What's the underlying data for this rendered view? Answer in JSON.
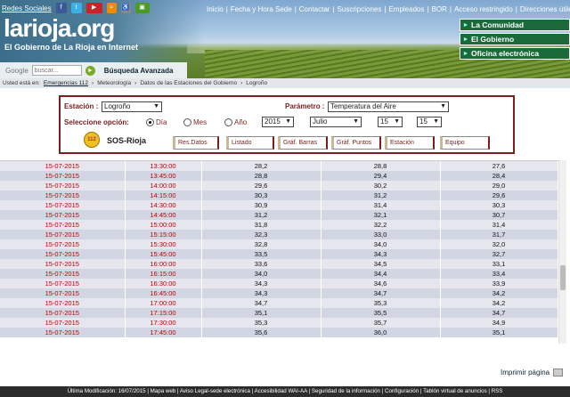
{
  "header": {
    "social_label": "Redes Sociales",
    "logo_main": "lariojа",
    "logo_text": "larioja",
    "logo_suffix": ".org",
    "tagline": "El Gobierno de La Rioja en Internet",
    "top_links": [
      "Inicio",
      "Fecha y Hora Sede",
      "Contactar",
      "Suscripciones",
      "Empleados",
      "BOR",
      "Acceso restringido",
      "Direcciones útiles"
    ],
    "quick_menu": [
      "La Comunidad",
      "El Gobierno",
      "Oficina electrónica"
    ],
    "search": {
      "label": "Google",
      "placeholder": "buscar...",
      "advanced": "Búsqueda Avanzada"
    }
  },
  "breadcrumb": {
    "prefix": "Usted está en:",
    "items": [
      "Emergencias 112",
      "Meteorología",
      "Datos de las Estaciones del Gobierno",
      "Logroño"
    ]
  },
  "form": {
    "station_label": "Estación :",
    "station_value": "Logroño",
    "param_label": "Parámetro :",
    "param_value": "Temperatura del Aire",
    "option_label": "Seleccione opción:",
    "radio_day": "Día",
    "radio_month": "Mes",
    "radio_year": "Año",
    "selected_option": "Día",
    "year": "2015",
    "month": "Julio",
    "day_from": "15",
    "day_to": "15",
    "sos_icon_text": "112",
    "sos_label": "SOS-Rioja",
    "tabs": [
      "Res.Datos",
      "Listado",
      "Gráf. Barras",
      "Gráf. Puntos",
      "Estación",
      "Equipo"
    ]
  },
  "table": {
    "rows": [
      [
        "15-07-2015",
        "13:30:00",
        "28,2",
        "28,8",
        "27,6"
      ],
      [
        "15-07-2015",
        "13:45:00",
        "28,8",
        "29,4",
        "28,4"
      ],
      [
        "15-07-2015",
        "14:00:00",
        "29,6",
        "30,2",
        "29,0"
      ],
      [
        "15-07-2015",
        "14:15:00",
        "30,3",
        "31,2",
        "29,6"
      ],
      [
        "15-07-2015",
        "14:30:00",
        "30,9",
        "31,4",
        "30,3"
      ],
      [
        "15-07-2015",
        "14:45:00",
        "31,2",
        "32,1",
        "30,7"
      ],
      [
        "15-07-2015",
        "15:00:00",
        "31,8",
        "32,2",
        "31,4"
      ],
      [
        "15-07-2015",
        "15:15:00",
        "32,3",
        "33,0",
        "31,7"
      ],
      [
        "15-07-2015",
        "15:30:00",
        "32,8",
        "34,0",
        "32,0"
      ],
      [
        "15-07-2015",
        "15:45:00",
        "33,5",
        "34,3",
        "32,7"
      ],
      [
        "15-07-2015",
        "16:00:00",
        "33,6",
        "34,5",
        "33,1"
      ],
      [
        "15-07-2015",
        "16:15:00",
        "34,0",
        "34,4",
        "33,4"
      ],
      [
        "15-07-2015",
        "16:30:00",
        "34,3",
        "34,6",
        "33,9"
      ],
      [
        "15-07-2015",
        "16:45:00",
        "34,3",
        "34,7",
        "34,2"
      ],
      [
        "15-07-2015",
        "17:00:00",
        "34,7",
        "35,3",
        "34,2"
      ],
      [
        "15-07-2015",
        "17:15:00",
        "35,1",
        "35,5",
        "34,7"
      ],
      [
        "15-07-2015",
        "17:30:00",
        "35,3",
        "35,7",
        "34,9"
      ],
      [
        "15-07-2015",
        "17:45:00",
        "35,6",
        "36,0",
        "35,1"
      ]
    ]
  },
  "print_label": "Imprimir página",
  "footer": "Última Modificación: 16/07/2015 | Mapa web | Aviso Legal-sede electrónica | Accesibilidad WAI-AA | Seguridad de la información | Configuración | Tablón virtual de anuncios | RSS",
  "colors": {
    "accent": "#7a1e1e",
    "menu_green": "#1b6b3a",
    "row_odd": "#e6e6ee",
    "row_even": "#d2d6e2"
  }
}
